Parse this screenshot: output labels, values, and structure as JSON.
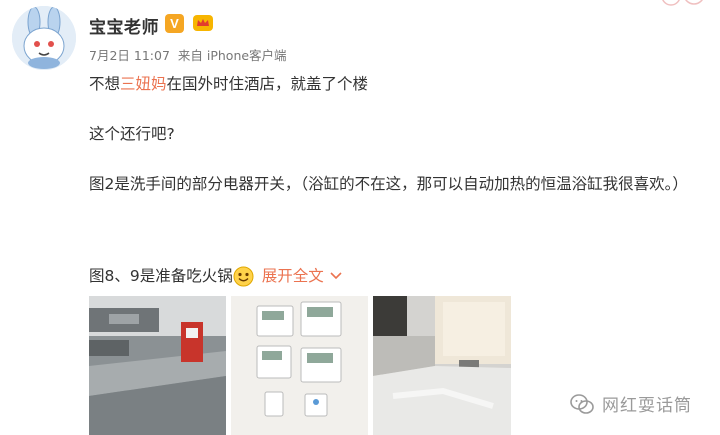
{
  "post": {
    "username": "宝宝老师",
    "vip_badge": "V",
    "date": "7月2日 11:07",
    "source": "来自 iPhone客户端",
    "line1_a": "不想",
    "line1_link": "三妞妈",
    "line1_b": "在国外时住酒店，就盖了个楼",
    "line2": "这个还行吧?",
    "line3": "图2是洗手间的部分电器开关，（浴缸的不在这，那可以自动加热的恒温浴缸我很喜欢。）",
    "line4": "图8、9是准备吃火锅",
    "expand_label": "展开全文"
  },
  "icons": {
    "avatar": "bunny-avatar",
    "vip": "verified-v-icon",
    "member": "member-crown-icon",
    "emoji": "smile-emoji-icon",
    "expand": "chevron-down-icon",
    "watermark": "wechat-icon"
  },
  "colors": {
    "link": "#eb7350",
    "vip": "#f5a623",
    "meta": "#777777",
    "text": "#333333"
  },
  "watermark": {
    "text": "网红耍话筒"
  }
}
